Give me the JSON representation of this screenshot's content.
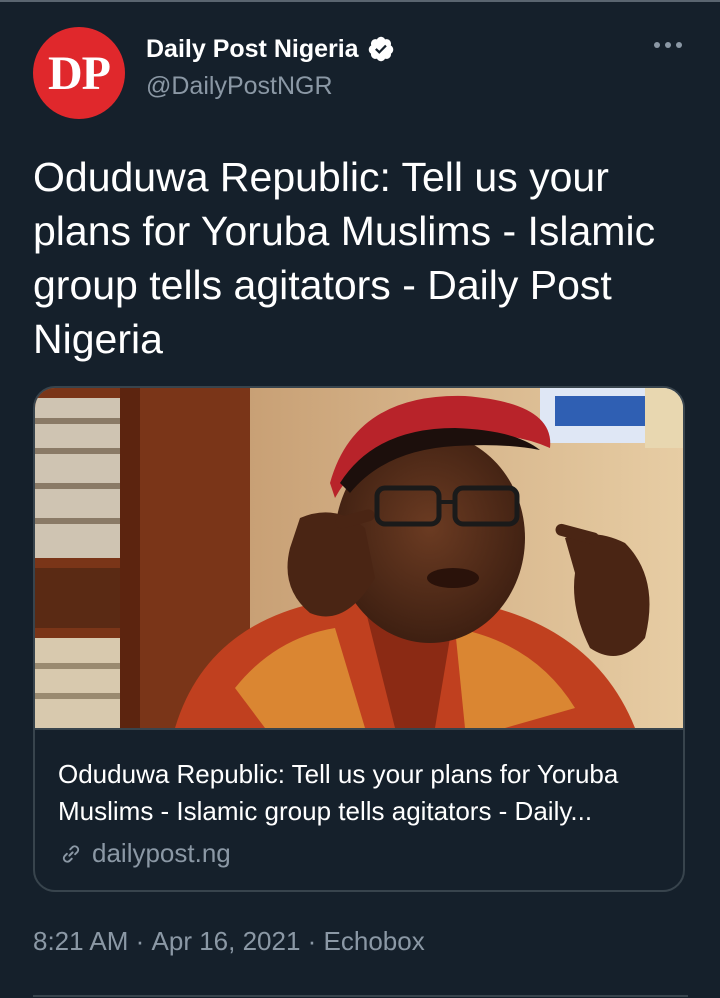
{
  "tweet": {
    "avatar_text": "DP",
    "display_name": "Daily Post Nigeria",
    "handle": "@DailyPostNGR",
    "text": "Oduduwa Republic: Tell us your plans for Yoruba Muslims - Islamic group tells agitators - Daily Post Nigeria",
    "timestamp_time": "8:21 AM",
    "separator": " · ",
    "timestamp_date": "Apr 16, 2021",
    "source": "Echobox"
  },
  "card": {
    "title": "Oduduwa Republic: Tell us your plans for Yoruba Muslims - Islamic group tells agitators - Daily...",
    "domain": "dailypost.ng"
  },
  "icons": {
    "verified": "verified-badge-icon",
    "more": "more-options-icon",
    "link": "link-icon"
  },
  "colors": {
    "background": "#15202b",
    "avatar": "#e0282c",
    "secondary_text": "#8b98a5",
    "border": "#38444d"
  }
}
